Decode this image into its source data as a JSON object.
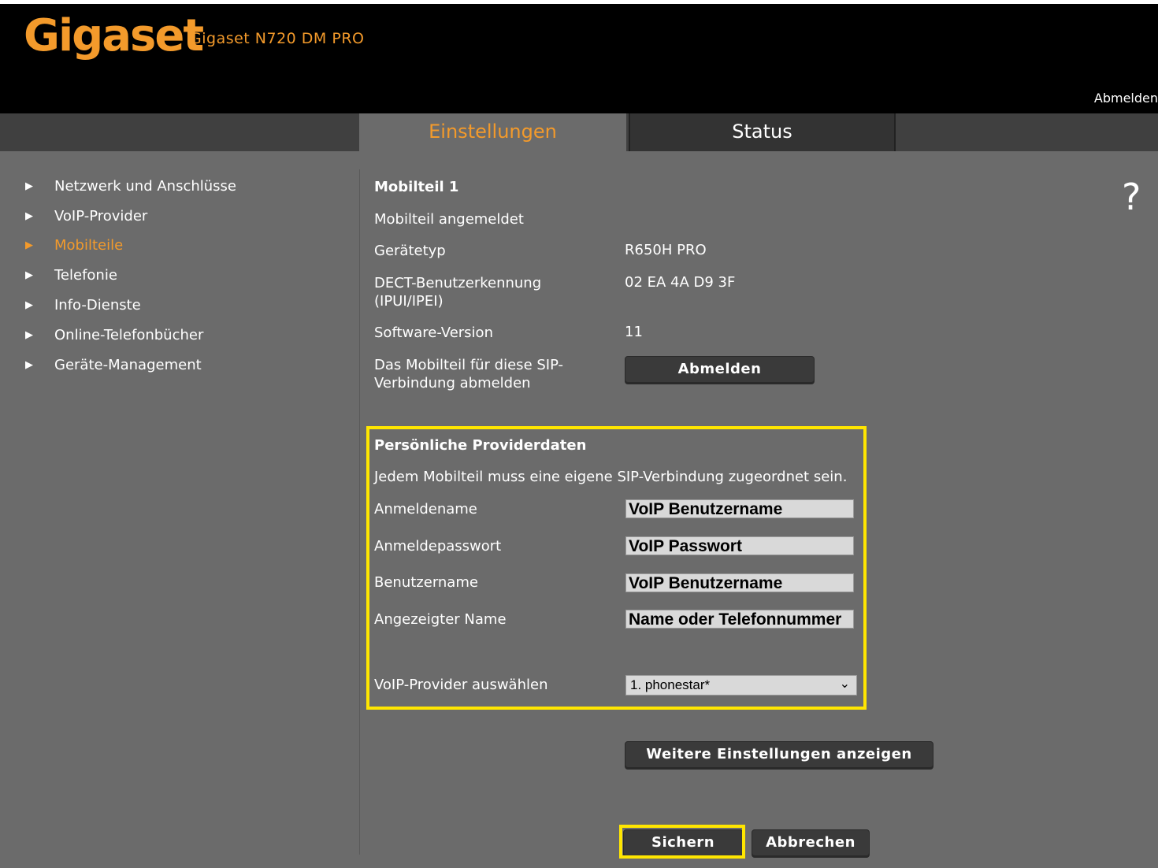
{
  "header": {
    "logo": "Gigaset",
    "device_name": "Gigaset N720 DM PRO",
    "logout": "Abmelden"
  },
  "tabs": {
    "settings": "Einstellungen",
    "status": "Status"
  },
  "sidebar": {
    "items": [
      {
        "label": "Netzwerk und Anschlüsse"
      },
      {
        "label": "VoIP-Provider"
      },
      {
        "label": "Mobilteile"
      },
      {
        "label": "Telefonie"
      },
      {
        "label": "Info-Dienste"
      },
      {
        "label": "Online-Telefonbücher"
      },
      {
        "label": "Geräte-Management"
      }
    ]
  },
  "help": "?",
  "handset": {
    "title": "Mobilteil 1",
    "status": "Mobilteil angemeldet",
    "device_type_label": "Gerätetyp",
    "device_type_value": "R650H PRO",
    "dect_label_1": "DECT-Benutzerkennung",
    "dect_label_2": "(IPUI/IPEI)",
    "dect_value": "02 EA 4A D9 3F",
    "software_label": "Software-Version",
    "software_value": "11",
    "deregister_label_1": "Das Mobilteil für diese SIP-",
    "deregister_label_2": "Verbindung abmelden",
    "deregister_button": "Abmelden"
  },
  "provider": {
    "title": "Persönliche Providerdaten",
    "note": "Jedem Mobilteil muss eine eigene SIP-Verbindung zugeordnet sein.",
    "login_name_label": "Anmeldename",
    "login_name_value": "VoIP Benutzername",
    "login_password_label": "Anmeldepasswort",
    "login_password_value": "VoIP Passwort",
    "username_label": "Benutzername",
    "username_value": "VoIP Benutzername",
    "display_name_label": "Angezeigter Name",
    "display_name_value": "Name oder Telefonnummer",
    "provider_select_label": "VoIP-Provider auswählen",
    "provider_select_value": "1. phonestar*"
  },
  "actions": {
    "more_settings": "Weitere Einstellungen anzeigen",
    "save": "Sichern",
    "cancel": "Abbrechen"
  },
  "colors": {
    "accent": "#f39a2b",
    "highlight": "#ffe600",
    "background": "#6b6b6b"
  }
}
